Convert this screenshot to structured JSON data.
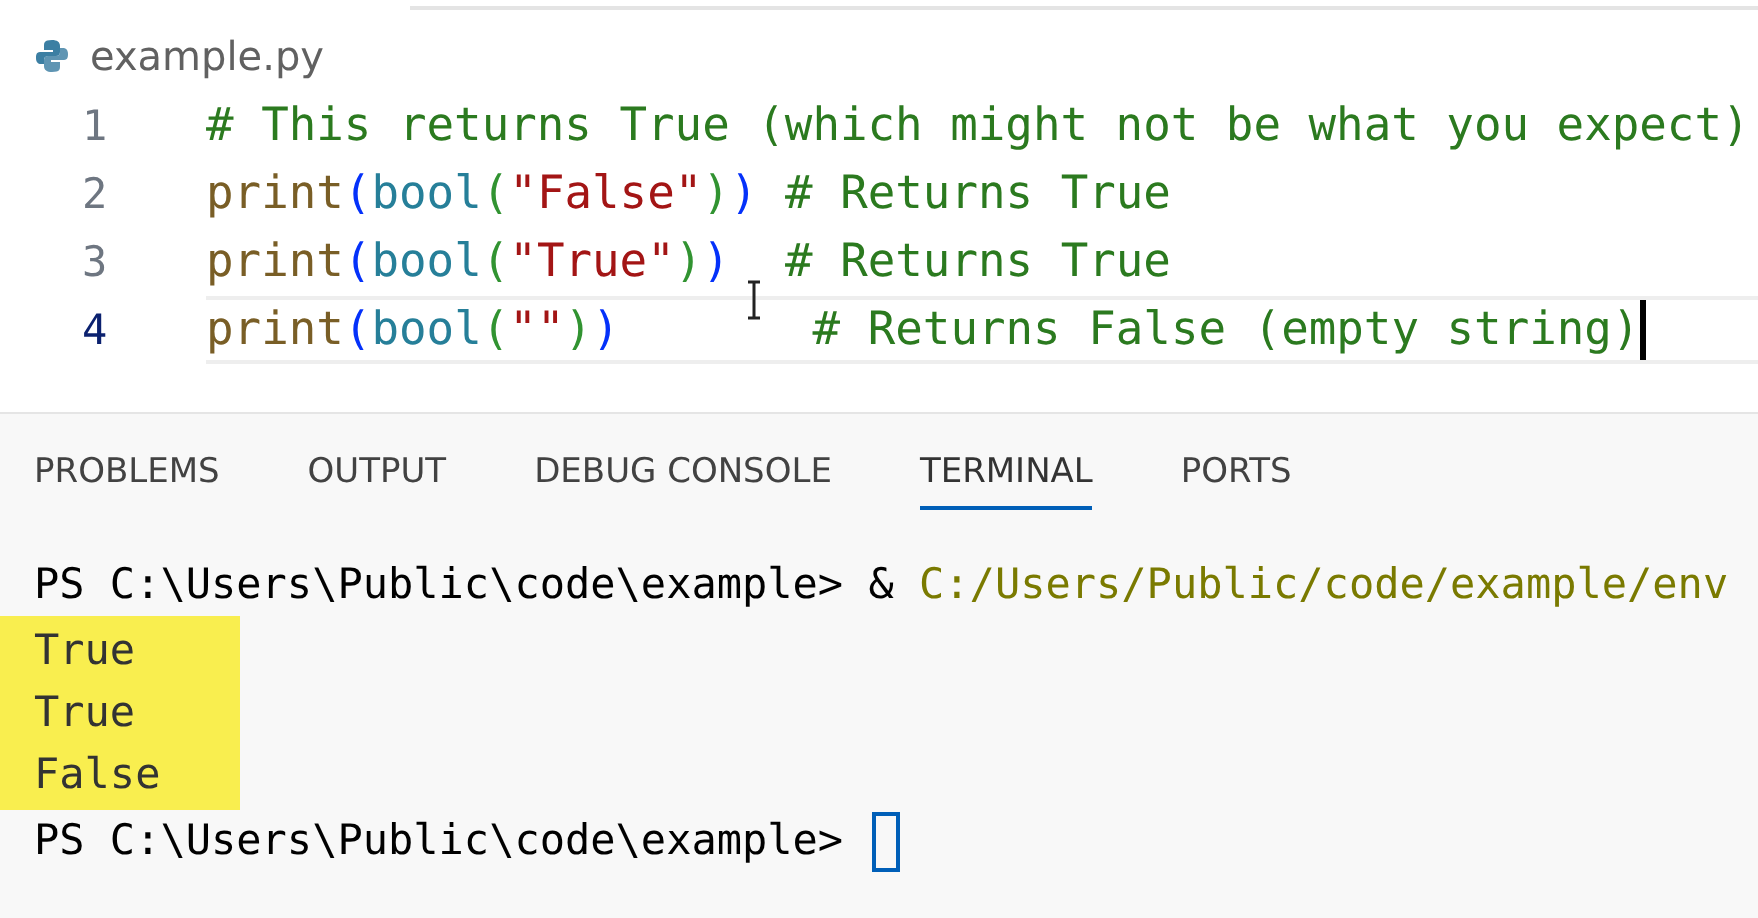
{
  "editor": {
    "file_name": "example.py",
    "lines": [
      {
        "number": "1",
        "active": false,
        "tokens": [
          {
            "kind": "comment",
            "text": "# This returns True (which might not be what you expect)"
          }
        ]
      },
      {
        "number": "2",
        "active": false,
        "tokens": [
          {
            "kind": "function",
            "text": "print"
          },
          {
            "kind": "bracket_1",
            "text": "("
          },
          {
            "kind": "class",
            "text": "bool"
          },
          {
            "kind": "bracket_2",
            "text": "("
          },
          {
            "kind": "string",
            "text": "\"False\""
          },
          {
            "kind": "bracket_2",
            "text": ")"
          },
          {
            "kind": "bracket_1",
            "text": ")"
          },
          {
            "kind": "comment",
            "text": " # Returns True"
          }
        ]
      },
      {
        "number": "3",
        "active": false,
        "tokens": [
          {
            "kind": "function",
            "text": "print"
          },
          {
            "kind": "bracket_1",
            "text": "("
          },
          {
            "kind": "class",
            "text": "bool"
          },
          {
            "kind": "bracket_2",
            "text": "("
          },
          {
            "kind": "string",
            "text": "\"True\""
          },
          {
            "kind": "bracket_2",
            "text": ")"
          },
          {
            "kind": "bracket_1",
            "text": ")"
          },
          {
            "kind": "comment",
            "text": "  # Returns True"
          }
        ]
      },
      {
        "number": "4",
        "active": true,
        "tokens": [
          {
            "kind": "function",
            "text": "print"
          },
          {
            "kind": "bracket_1",
            "text": "("
          },
          {
            "kind": "class",
            "text": "bool"
          },
          {
            "kind": "bracket_2",
            "text": "("
          },
          {
            "kind": "string",
            "text": "\"\""
          },
          {
            "kind": "bracket_2",
            "text": ")"
          },
          {
            "kind": "bracket_1",
            "text": ")"
          },
          {
            "kind": "comment",
            "text": "       # Returns False (empty string)"
          }
        ]
      }
    ]
  },
  "panel": {
    "tabs": [
      {
        "label": "PROBLEMS",
        "selected": false
      },
      {
        "label": "OUTPUT",
        "selected": false
      },
      {
        "label": "DEBUG CONSOLE",
        "selected": false
      },
      {
        "label": "TERMINAL",
        "selected": true
      },
      {
        "label": "PORTS",
        "selected": false
      }
    ],
    "terminal": {
      "lines": [
        {
          "kind": "prompt",
          "cursor": false,
          "tokens": [
            {
              "kind": "plain",
              "text": "PS C:\\Users\\Public\\code\\example> & "
            },
            {
              "kind": "path",
              "text": "C:/Users/Public/code/example/env"
            }
          ]
        },
        {
          "kind": "output",
          "highlighted": true,
          "text": "True"
        },
        {
          "kind": "output",
          "highlighted": true,
          "text": "True"
        },
        {
          "kind": "output",
          "highlighted": true,
          "text": "False"
        },
        {
          "kind": "prompt",
          "cursor": true,
          "tokens": [
            {
              "kind": "plain",
              "text": "PS C:\\Users\\Public\\code\\example> "
            }
          ]
        }
      ]
    }
  }
}
